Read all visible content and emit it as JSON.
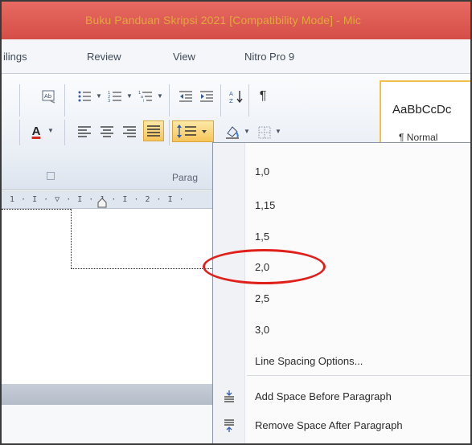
{
  "window": {
    "title": "Buku Panduan Skripsi 2021 [Compatibility Mode]  -  Mic"
  },
  "tabs": [
    {
      "label": "ilings"
    },
    {
      "label": "Review"
    },
    {
      "label": "View"
    },
    {
      "label": "Nitro Pro 9"
    }
  ],
  "ribbon": {
    "paragraph_group_label": "Parag",
    "styles": {
      "sample": "AaBbCcDc",
      "name": "¶ Normal"
    }
  },
  "ruler": {
    "text": "1 · I · ▽ · I · 1 · I · 2 · I ·"
  },
  "line_spacing_menu": {
    "options": [
      {
        "label": "1,0"
      },
      {
        "label": "1,15"
      },
      {
        "label": "1,5"
      },
      {
        "label": "2,0",
        "circled": true
      },
      {
        "label": "2,5"
      },
      {
        "label": "3,0"
      }
    ],
    "options_link": "Line Spacing Options...",
    "add_space_before": "Add Space Before Paragraph",
    "remove_space_after": "Remove Space After Paragraph"
  },
  "colors": {
    "highlight_circle": "#e0201b",
    "title_bar": "#d44e47",
    "active_button": "#f6c45a"
  }
}
